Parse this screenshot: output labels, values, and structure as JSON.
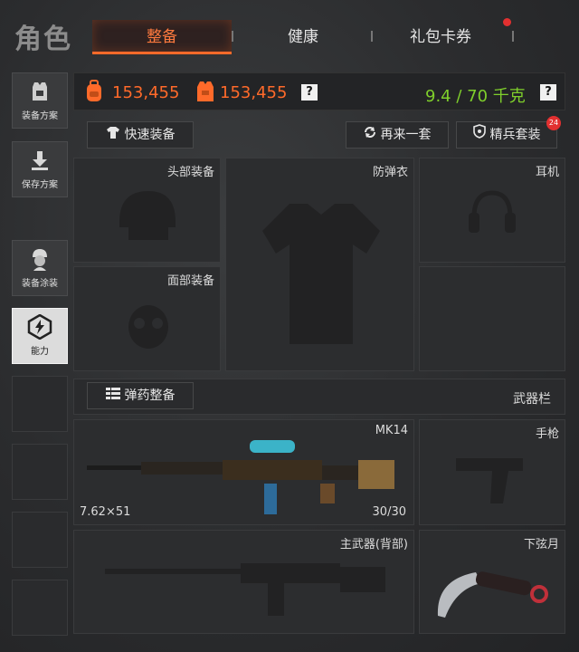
{
  "header": {
    "title": "角色",
    "tabs": [
      {
        "label": "整备",
        "active": true
      },
      {
        "label": "健康",
        "active": false
      },
      {
        "label": "礼包卡券",
        "active": false
      }
    ],
    "notification_dot": true
  },
  "sidebar": {
    "items": [
      {
        "label": "装备方案",
        "icon": "vest-icon"
      },
      {
        "label": "保存方案",
        "icon": "download-icon"
      },
      {
        "label": "装备涂装",
        "icon": "soldier-icon"
      },
      {
        "label": "能力",
        "icon": "lightning-icon",
        "active": true
      }
    ]
  },
  "stats": {
    "backpack_value": "153,455",
    "vest_value": "153,455",
    "help": "?",
    "weight": "9.4 / 70 千克",
    "weight_help": "?"
  },
  "actions": {
    "quick_equip": "快速装备",
    "another_set": "再来一套",
    "elite_set": "精兵套装",
    "elite_badge": "24"
  },
  "slots": {
    "head": "头部装备",
    "armor": "防弹衣",
    "headset": "耳机",
    "face": "面部装备"
  },
  "weapons": {
    "ammo_button": "弹药整备",
    "weapon_bar_label": "武器栏",
    "primary_name": "MK14",
    "primary_caliber": "7.62×51",
    "primary_ammo": "30/30",
    "pistol": "手枪",
    "secondary_primary": "主武器(背部)",
    "melee": "下弦月"
  },
  "colors": {
    "accent": "#ff6a2a",
    "weight_green": "#7fcf2b",
    "badge_red": "#e23030"
  }
}
